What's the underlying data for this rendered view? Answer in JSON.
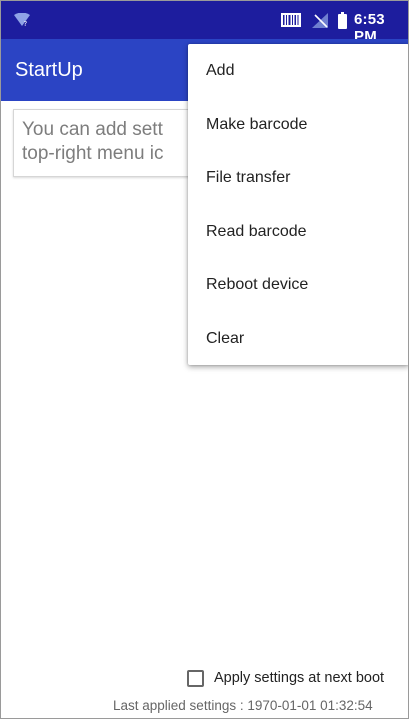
{
  "status_bar": {
    "time": "6:53 PM",
    "icons": [
      "wifi-question-icon",
      "barcode-scanner-icon",
      "no-signal-icon",
      "battery-icon"
    ],
    "background": "#1d1d9e"
  },
  "app_bar": {
    "title": "StartUp",
    "background": "#2b44c4"
  },
  "main": {
    "info_text": "You can add sett\ntop-right menu ic"
  },
  "overflow_menu": {
    "items": [
      {
        "label": "Add"
      },
      {
        "label": "Make barcode"
      },
      {
        "label": "File transfer"
      },
      {
        "label": "Read barcode"
      },
      {
        "label": "Reboot device"
      },
      {
        "label": "Clear"
      }
    ]
  },
  "footer": {
    "apply_label": "Apply settings at next boot",
    "apply_checked": false,
    "last_applied": "Last applied settings : 1970-01-01 01:32:54"
  }
}
